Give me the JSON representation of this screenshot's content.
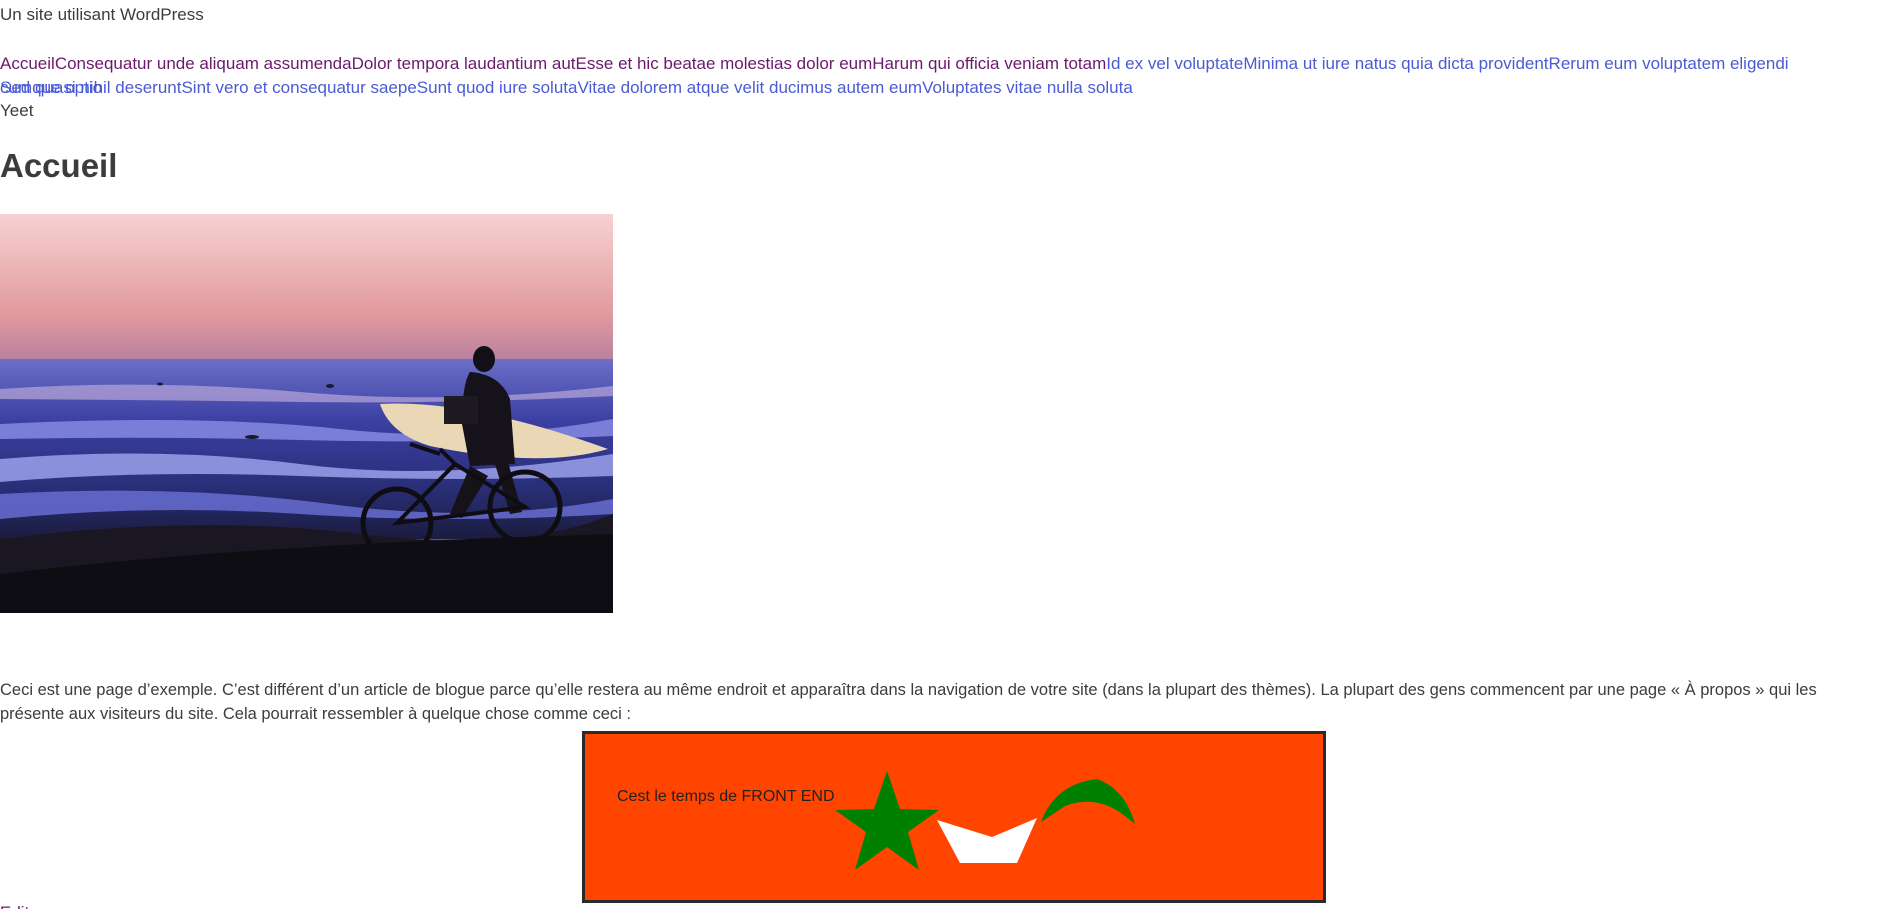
{
  "site": {
    "title": "Un site utilisant WordPress"
  },
  "nav": {
    "line1": [
      {
        "label": "Accueil",
        "state": "visited"
      },
      {
        "label": "Consequatur unde aliquam assumenda",
        "state": "visited"
      },
      {
        "label": "Dolor tempora laudantium aut",
        "state": "visited"
      },
      {
        "label": "Esse et hic beatae molestias dolor eum",
        "state": "visited"
      },
      {
        "label": "Harum qui officia veniam totam",
        "state": "visited"
      },
      {
        "label": "Id ex vel voluptate",
        "state": "unvisited"
      },
      {
        "label": "Minima ut iure natus quia dicta provident",
        "state": "unvisited"
      },
      {
        "label": "Rerum eum voluptatem eligendi cumque optio",
        "state": "unvisited"
      }
    ],
    "line2": [
      {
        "label": "Sed quasi nihil deserunt",
        "state": "unvisited"
      },
      {
        "label": "Sint vero et consequatur saepe",
        "state": "unvisited"
      },
      {
        "label": "Sunt quod iure soluta",
        "state": "unvisited"
      },
      {
        "label": "Vitae dolorem atque velit ducimus autem eum",
        "state": "unvisited"
      },
      {
        "label": "Voluptates vitae nulla soluta",
        "state": "unvisited"
      }
    ],
    "extra": "Yeet"
  },
  "main": {
    "page_title": "Accueil",
    "intro": "Ceci est une page d’exemple. C’est différent d’un article de blogue parce qu’elle restera au même endroit et apparaîtra dans la navigation de votre site (dans la plupart des thèmes). La plupart des gens commencent par une page « À propos » qui les présente aux visiteurs du site. Cela pourrait ressembler à quelque chose comme ceci :",
    "banner_text": "Cest le temps de FRONT END",
    "edit_label": "Edit"
  },
  "colors": {
    "link_visited": "#6b1a6b",
    "link_unvisited": "#4a5bd4",
    "banner_bg": "#ff4500",
    "star": "#008000",
    "boat": "#ffffff"
  },
  "icons": {
    "hero": "surfer-bicycle-sunset-photo",
    "star": "star-shape",
    "boat": "boat-shape",
    "arc": "green-arc-shape"
  }
}
